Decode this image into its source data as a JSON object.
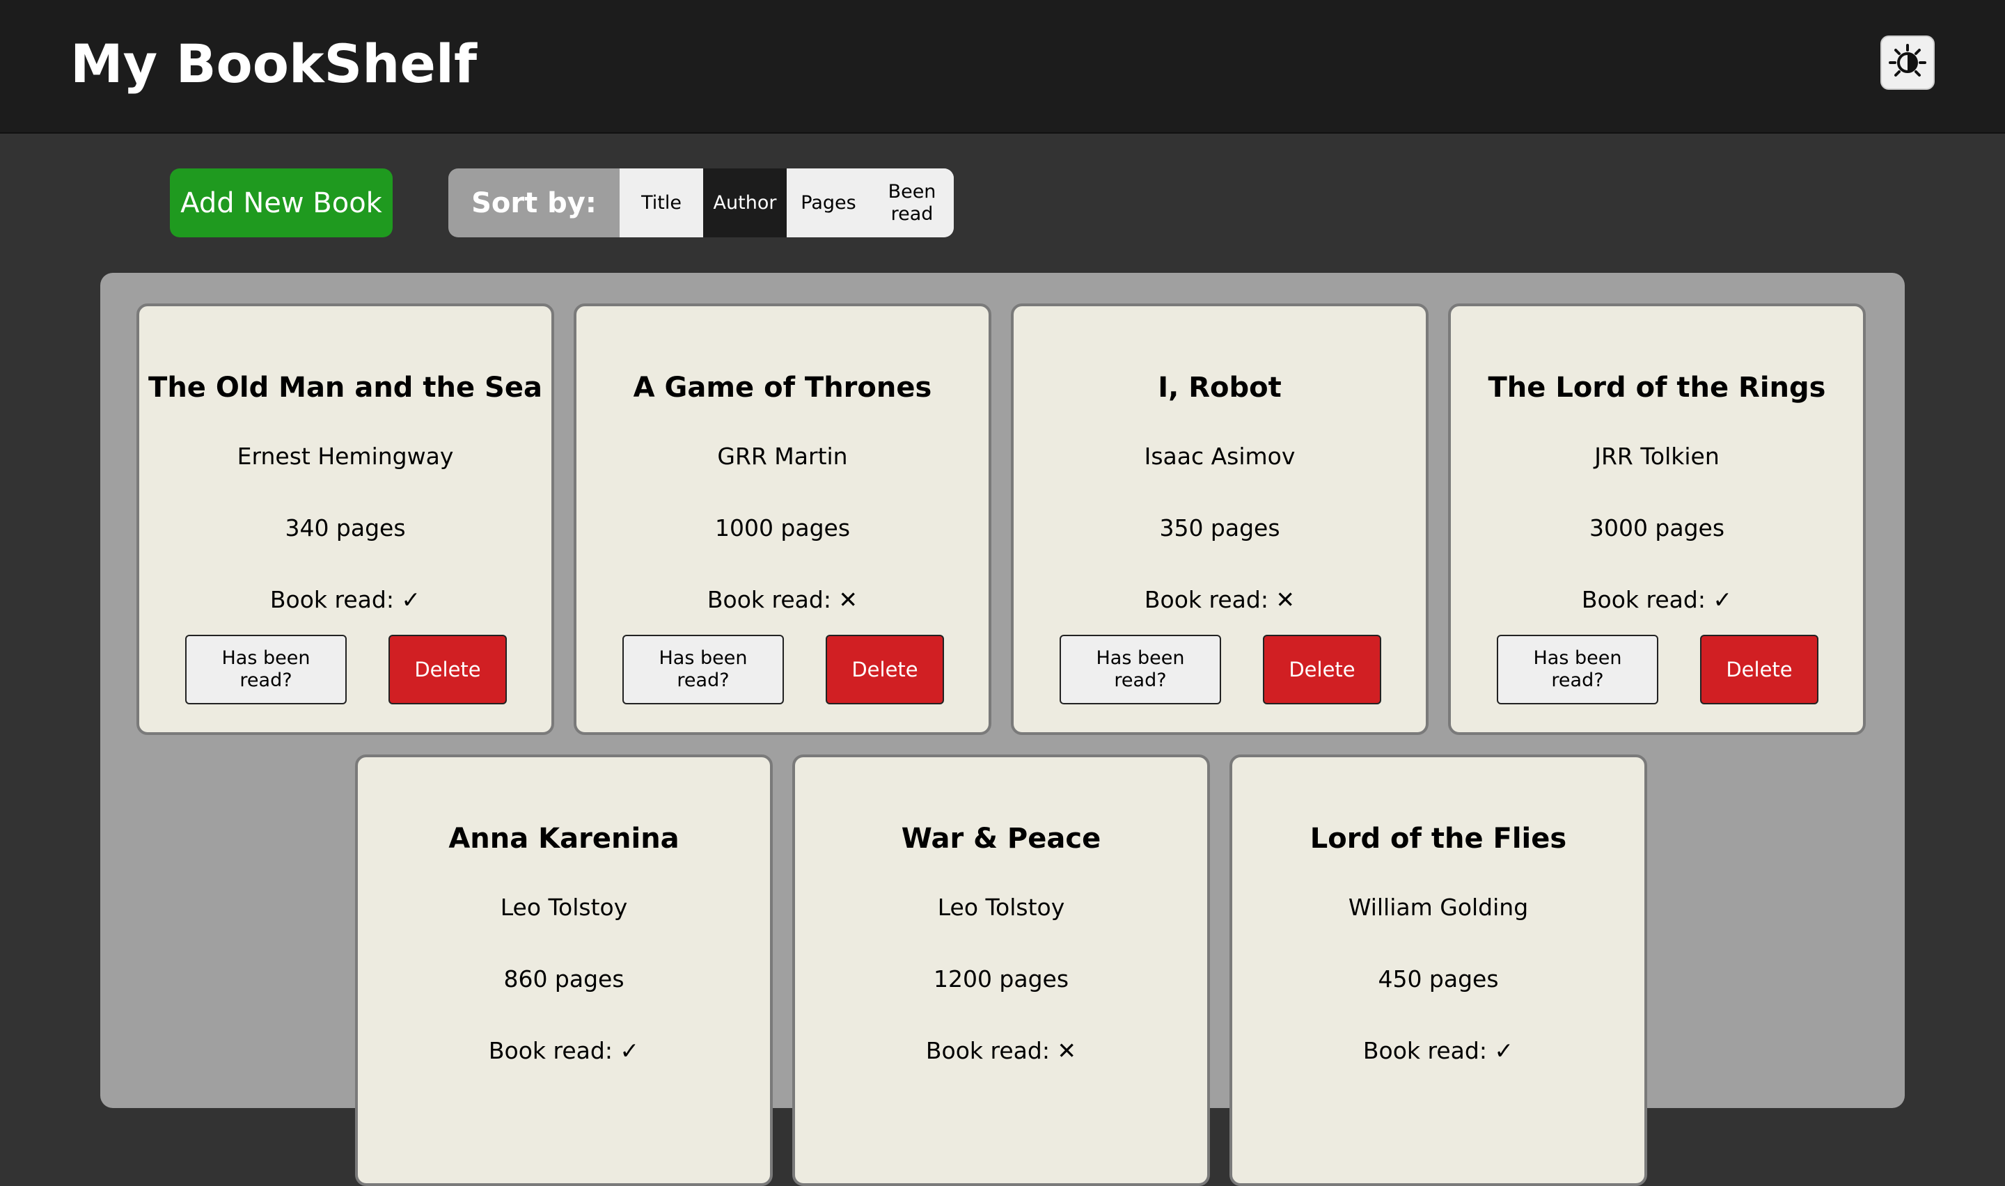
{
  "header": {
    "title": "My BookShelf",
    "theme_toggle_icon": "sun-moon-icon"
  },
  "toolbar": {
    "add_label": "Add New Book",
    "sort_label": "Sort by:",
    "sort_options": [
      "Title",
      "Author",
      "Pages",
      "Been read"
    ],
    "active_sort": "Author"
  },
  "colors": {
    "accent_green": "#1f9a1f",
    "delete_red": "#d11f23",
    "card_bg": "#edebe0",
    "header_bg": "#1c1c1c"
  },
  "card_actions": {
    "toggle_label": "Has been read?",
    "delete_label": "Delete"
  },
  "books": [
    {
      "title": "The Old Man and the Sea",
      "author": "Ernest Hemingway",
      "pages": "340 pages",
      "read": "Book read: ✓"
    },
    {
      "title": "A Game of Thrones",
      "author": "GRR Martin",
      "pages": "1000 pages",
      "read": "Book read: ✕"
    },
    {
      "title": "I, Robot",
      "author": "Isaac Asimov",
      "pages": "350 pages",
      "read": "Book read: ✕"
    },
    {
      "title": "The Lord of the Rings",
      "author": "JRR Tolkien",
      "pages": "3000 pages",
      "read": "Book read: ✓"
    },
    {
      "title": "Anna Karenina",
      "author": "Leo Tolstoy",
      "pages": "860 pages",
      "read": "Book read: ✓"
    },
    {
      "title": "War & Peace",
      "author": "Leo Tolstoy",
      "pages": "1200 pages",
      "read": "Book read: ✕"
    },
    {
      "title": "Lord of the Flies",
      "author": "William Golding",
      "pages": "450 pages",
      "read": "Book read: ✓"
    }
  ]
}
